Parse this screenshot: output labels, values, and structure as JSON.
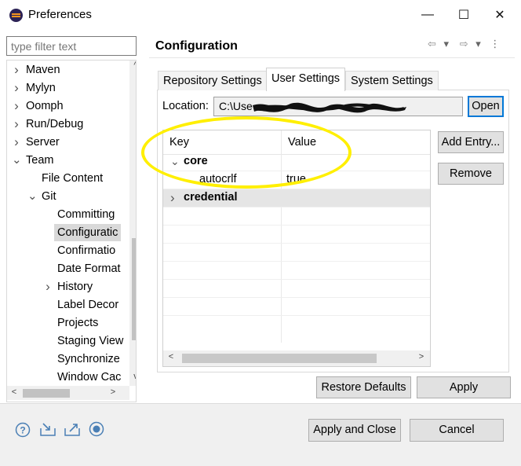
{
  "window": {
    "title": "Preferences",
    "controls": {
      "minimize": "—",
      "maximize": "☐",
      "close": "✕"
    }
  },
  "left": {
    "filter_placeholder": "type filter text",
    "tree": [
      {
        "label": "Maven",
        "expander": "›"
      },
      {
        "label": "Mylyn",
        "expander": "›"
      },
      {
        "label": "Oomph",
        "expander": "›"
      },
      {
        "label": "Run/Debug",
        "expander": "›"
      },
      {
        "label": "Server",
        "expander": "›"
      },
      {
        "label": "Team",
        "expander": "⌄"
      },
      {
        "label": "File Content",
        "expander": ""
      },
      {
        "label": "Git",
        "expander": "⌄"
      },
      {
        "label": "Committing",
        "expander": ""
      },
      {
        "label": "Configuratic",
        "expander": "",
        "selected": true
      },
      {
        "label": "Confirmatio",
        "expander": ""
      },
      {
        "label": "Date Format",
        "expander": ""
      },
      {
        "label": "History",
        "expander": "›"
      },
      {
        "label": "Label Decor",
        "expander": ""
      },
      {
        "label": "Projects",
        "expander": ""
      },
      {
        "label": "Staging View",
        "expander": ""
      },
      {
        "label": "Synchronize",
        "expander": ""
      },
      {
        "label": "Window Cac",
        "expander": ""
      }
    ]
  },
  "right": {
    "title": "Configuration",
    "nav_icons": {
      "back": "⇦",
      "back_menu": "▾",
      "forward": "⇨",
      "forward_menu": "▾",
      "more": "⋮"
    },
    "tabs": [
      "Repository Settings",
      "User Settings",
      "System Settings"
    ],
    "location_label": "Location:",
    "location_value": "C:\\Use",
    "open_label": "Open",
    "table": {
      "headers": [
        "Key",
        "Value"
      ],
      "rows": [
        {
          "key": "core",
          "value": "",
          "bold": true,
          "expander": "⌄"
        },
        {
          "key": "autocrlf",
          "value": "true",
          "bold": false,
          "expander": ""
        },
        {
          "key": "credential",
          "value": "",
          "bold": true,
          "expander": "›"
        }
      ]
    },
    "add_entry_label": "Add Entry...",
    "remove_label": "Remove",
    "restore_defaults_label": "Restore Defaults",
    "apply_label": "Apply"
  },
  "footer": {
    "apply_and_close_label": "Apply and Close",
    "cancel_label": "Cancel",
    "icons": [
      "help-icon",
      "import-icon",
      "export-icon",
      "record-icon"
    ]
  },
  "colors": {
    "accent": "#0078d7",
    "highlight": "#ffef00",
    "selection": "#d9d9d9"
  }
}
